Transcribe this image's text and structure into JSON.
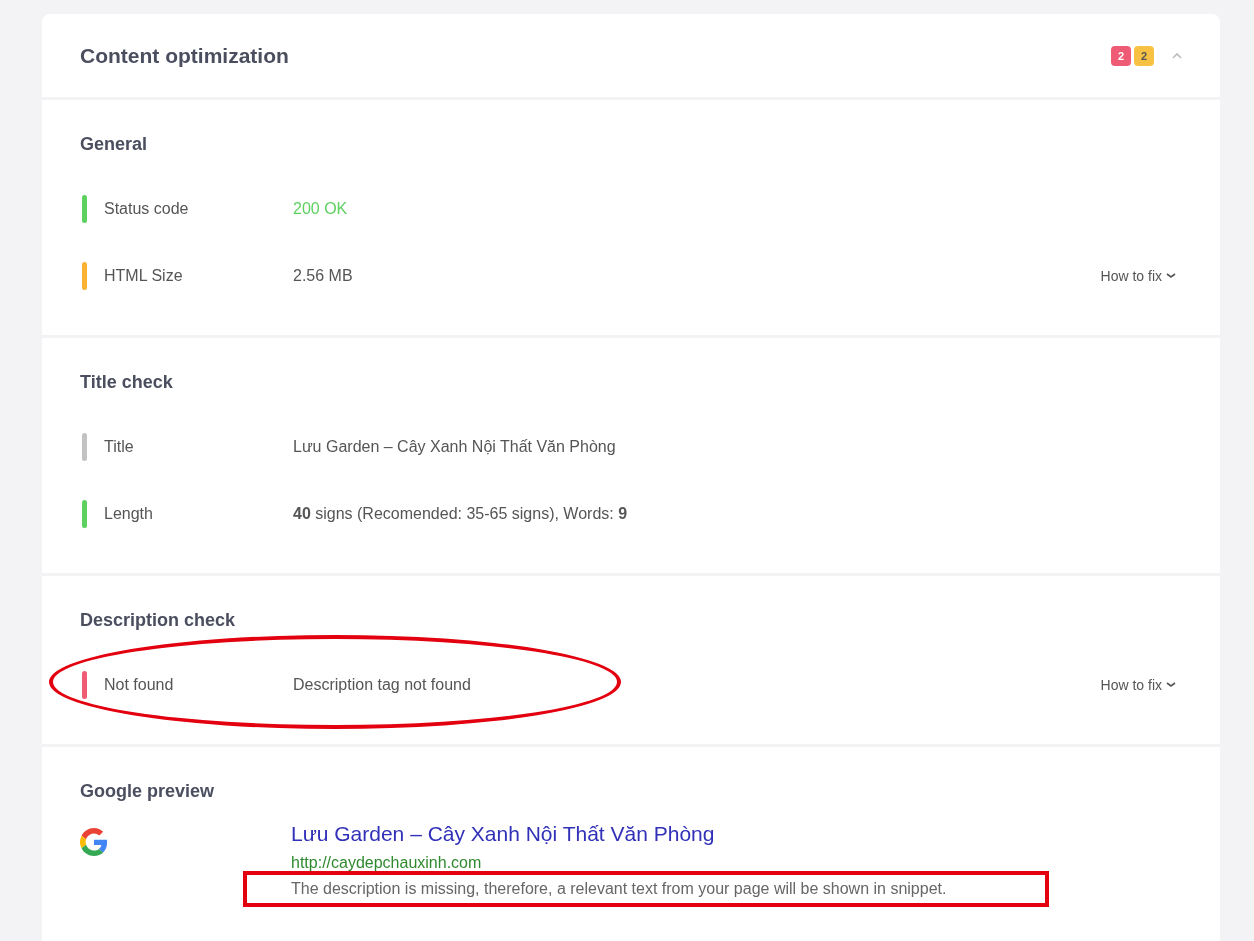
{
  "card": {
    "title": "Content optimization",
    "badges": [
      {
        "count": "2",
        "color": "#ef5a75"
      },
      {
        "count": "2",
        "color": "#f7c244"
      }
    ],
    "expanded": true
  },
  "sections": [
    {
      "title": "General",
      "rows": [
        {
          "label": "Status code",
          "value": "200 OK",
          "color": "#5cd160",
          "value_ok": true
        },
        {
          "label": "HTML Size",
          "value": "2.56 MB",
          "color": "#f9b232",
          "how_to_fix": "How to fix"
        }
      ]
    },
    {
      "title": "Title check",
      "rows": [
        {
          "label": "Title",
          "value": "Lưu Garden – Cây Xanh Nội Thất Văn Phòng",
          "color": "#c2c2c2"
        },
        {
          "label": "Length",
          "value": "**40** signs (Recomended: 35-65 signs), Words: **9**",
          "color": "#5cd160"
        }
      ]
    },
    {
      "title": "Description check",
      "rows": [
        {
          "label": "Not found",
          "value": "Description tag not found",
          "color": "#ef5a75",
          "how_to_fix": "How to fix",
          "circled": true
        }
      ]
    }
  ],
  "google_preview": {
    "title": "Google preview",
    "link": "Lưu Garden – Cây Xanh Nội Thất Văn Phòng",
    "url": "http://caydepchauxinh.com",
    "snippet": "The description is missing, therefore, a relevant text from your page will be shown in snippet.",
    "boxed": true
  }
}
